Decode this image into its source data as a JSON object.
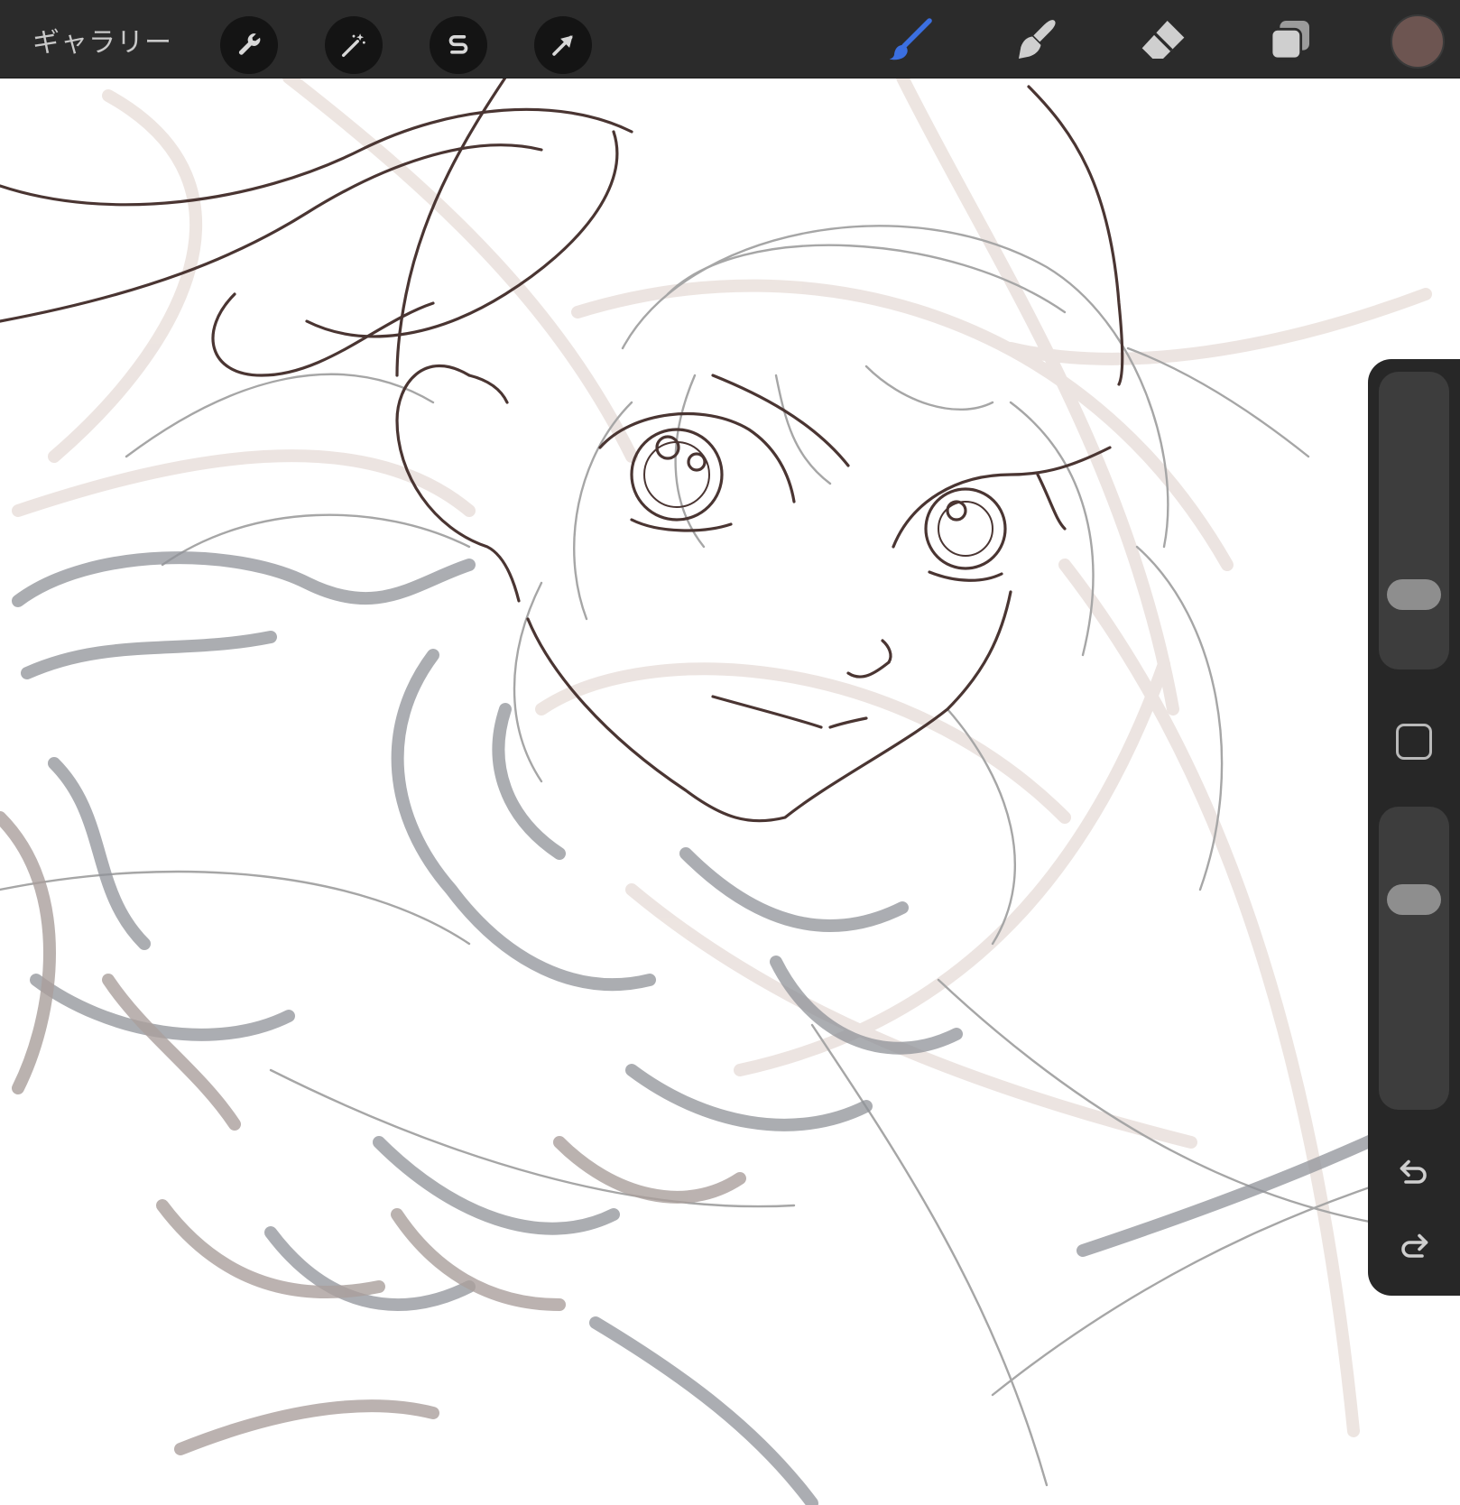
{
  "topbar": {
    "gallery_label": "ギャラリー",
    "left_tools": [
      {
        "name": "actions",
        "icon": "wrench-icon"
      },
      {
        "name": "adjustments",
        "icon": "magic-wand-icon"
      },
      {
        "name": "selection",
        "icon": "selection-s-icon"
      },
      {
        "name": "transform",
        "icon": "arrow-cursor-icon"
      }
    ],
    "right_tools": [
      {
        "name": "brush",
        "icon": "brush-icon",
        "active": true
      },
      {
        "name": "smudge",
        "icon": "smudge-finger-icon"
      },
      {
        "name": "eraser",
        "icon": "eraser-icon"
      },
      {
        "name": "layers",
        "icon": "layers-icon"
      }
    ],
    "active_color": "#6d5551",
    "active_tool_color": "#3b6fe0"
  },
  "sidebar": {
    "brush_size_slider": {
      "level": 0.35
    },
    "opacity_slider": {
      "level": 0.27
    },
    "modify_button_icon": "square-icon",
    "undo_icon": "undo-icon",
    "redo_icon": "redo-icon"
  },
  "canvas": {
    "sketch_colors": {
      "lineart": "#4a3532",
      "pencil_grey": "#8d9096",
      "rough_brown": "#a69a97",
      "light_guides": "#e9dfdb"
    }
  }
}
